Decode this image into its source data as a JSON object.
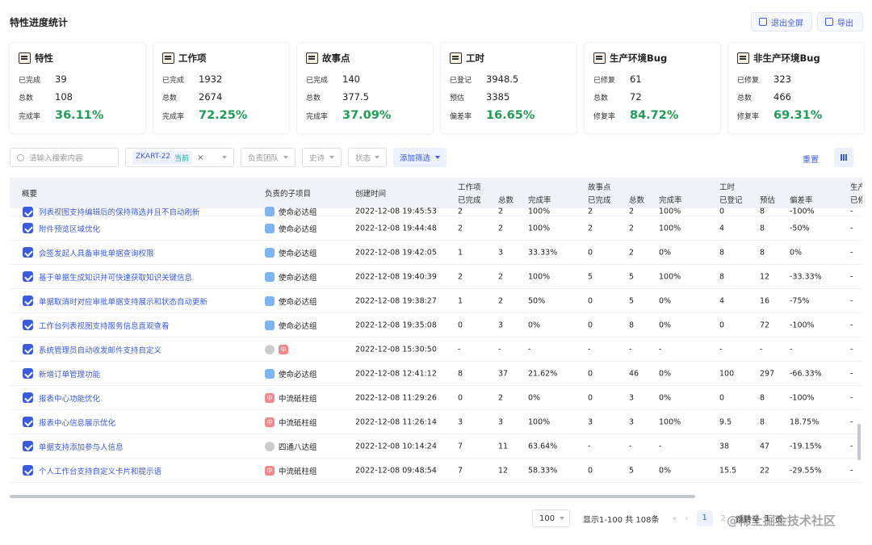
{
  "header": {
    "title": "特性进度统计",
    "exit_fullscreen": "退出全屏",
    "export": "导出"
  },
  "cards": [
    {
      "title": "特性",
      "icon": "feature-icon",
      "r1_label": "已完成",
      "r1_value": "39",
      "r2_label": "总数",
      "r2_value": "108",
      "r3_label": "完成率",
      "r3_value": "36.11%"
    },
    {
      "title": "工作项",
      "icon": "workitem-icon",
      "r1_label": "已完成",
      "r1_value": "1932",
      "r2_label": "总数",
      "r2_value": "2674",
      "r3_label": "完成率",
      "r3_value": "72.25%"
    },
    {
      "title": "故事点",
      "icon": "storypoint-icon",
      "r1_label": "已完成",
      "r1_value": "140",
      "r2_label": "总数",
      "r2_value": "377.5",
      "r3_label": "完成率",
      "r3_value": "37.09%"
    },
    {
      "title": "工时",
      "icon": "worktime-icon",
      "r1_label": "已登记",
      "r1_value": "3948.5",
      "r2_label": "预估",
      "r2_value": "3385",
      "r3_label": "偏差率",
      "r3_value": "16.65%"
    },
    {
      "title": "生产环境Bug",
      "icon": "bug-icon",
      "r1_label": "已修复",
      "r1_value": "61",
      "r2_label": "总数",
      "r2_value": "72",
      "r3_label": "修复率",
      "r3_value": "84.72%"
    },
    {
      "title": "非生产环境Bug",
      "icon": "bug-icon",
      "r1_label": "已修复",
      "r1_value": "323",
      "r2_label": "总数",
      "r2_value": "466",
      "r3_label": "修复率",
      "r3_value": "69.31%"
    }
  ],
  "filters": {
    "search_placeholder": "请输入搜索内容",
    "sprint_tag": "ZKART-22",
    "sprint_current": "当前",
    "team": "负责团队",
    "epic": "史诗",
    "status": "状态",
    "add_filter": "添加筛选",
    "reset": "重置"
  },
  "table": {
    "headers": {
      "summary": "概要",
      "project": "负责的子项目",
      "created": "创建时间",
      "workitem": "工作项",
      "storypoint": "故事点",
      "worktime": "工时",
      "prod": "生产",
      "done": "已完成",
      "total": "总数",
      "rate": "完成率",
      "logged": "已登记",
      "estimate": "预估",
      "deviation": "偏差率",
      "fixed": "已修"
    },
    "rows": [
      [
        "列表视图支持编辑后的保持筛选并且不自动刷新",
        "使命必达组",
        "2022-12-08 19:45:53",
        "2",
        "2",
        "100%",
        "2",
        "2",
        "100%",
        "0",
        "8",
        "-100%",
        "-"
      ],
      [
        "附件预览区域优化",
        "使命必达组",
        "2022-12-08 19:44:48",
        "2",
        "2",
        "100%",
        "2",
        "2",
        "100%",
        "4",
        "8",
        "-50%",
        "-"
      ],
      [
        "会签发起人具备审批单据查询权限",
        "使命必达组",
        "2022-12-08 19:42:05",
        "1",
        "3",
        "33.33%",
        "0",
        "2",
        "0%",
        "8",
        "8",
        "0%",
        "-"
      ],
      [
        "基于单据生成知识并可快速获取知识关键信息",
        "使命必达组",
        "2022-12-08 19:40:39",
        "2",
        "2",
        "100%",
        "5",
        "5",
        "100%",
        "8",
        "12",
        "-33.33%",
        "-"
      ],
      [
        "单据取消时对应审批单据支持展示和状态自动更新",
        "使命必达组",
        "2022-12-08 19:38:27",
        "1",
        "2",
        "50%",
        "0",
        "5",
        "0%",
        "4",
        "16",
        "-75%",
        "-"
      ],
      [
        "工作台列表视图支持服务信息直观查看",
        "使命必达组",
        "2022-12-08 19:35:08",
        "0",
        "3",
        "0%",
        "0",
        "8",
        "0%",
        "0",
        "72",
        "-100%",
        "-"
      ],
      [
        "系统管理员自动收发邮件支持自定义",
        "中",
        "2022-12-08 15:30:50",
        "-",
        "-",
        "-",
        "-",
        "-",
        "-",
        "-",
        "-",
        "-",
        "-"
      ],
      [
        "新增订单管理功能",
        "使命必达组",
        "2022-12-08 12:41:12",
        "8",
        "37",
        "21.62%",
        "0",
        "46",
        "0%",
        "100",
        "297",
        "-66.33%",
        "-"
      ],
      [
        "报表中心功能优化",
        "中流砥柱组",
        "2022-12-08 11:29:26",
        "0",
        "2",
        "0%",
        "0",
        "3",
        "0%",
        "0",
        "8",
        "-100%",
        "-"
      ],
      [
        "报表中心信息展示优化",
        "中流砥柱组",
        "2022-12-08 11:26:14",
        "3",
        "3",
        "100%",
        "3",
        "3",
        "100%",
        "9.5",
        "8",
        "18.75%",
        "-"
      ],
      [
        "单据支持添加参与人信息",
        "四通八达组",
        "2022-12-08 10:14:24",
        "7",
        "11",
        "63.64%",
        "-",
        "-",
        "-",
        "38",
        "47",
        "-19.15%",
        "-"
      ],
      [
        "个人工作台支持自定义卡片和提示语",
        "中流砥柱组",
        "2022-12-08 09:48:54",
        "7",
        "12",
        "58.33%",
        "0",
        "5",
        "0%",
        "15.5",
        "22",
        "-29.55%",
        "-"
      ]
    ],
    "row_avatars": [
      "blue",
      "blue",
      "blue",
      "blue",
      "blue",
      "blue",
      "gray-red",
      "blue",
      "red",
      "red",
      "gray",
      "red"
    ]
  },
  "pager": {
    "page_size": "100",
    "info": "显示1-100 共 108条",
    "current_page": "1",
    "page_2": "2",
    "jump_label": "跳转至",
    "jump_value": "1",
    "page_unit": "页"
  },
  "watermark": "@稀土掘金技术社区"
}
